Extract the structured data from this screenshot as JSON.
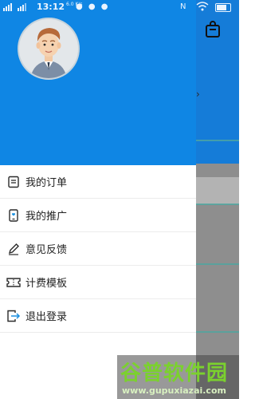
{
  "status_bar": {
    "time": "13:12",
    "speed": "6.0 K/s",
    "right_icons": "N",
    "signal_icon": "signal-bars-icon",
    "wifi_icon": "wifi-icon",
    "battery_icon": "battery-icon"
  },
  "drawer": {
    "avatar_icon": "user-avatar-icon",
    "menu": [
      {
        "label": "我的订单",
        "icon": "order-list-icon"
      },
      {
        "label": "我的推广",
        "icon": "promotion-phone-icon"
      },
      {
        "label": "意见反馈",
        "icon": "pencil-feedback-icon"
      },
      {
        "label": "计费模板",
        "icon": "ticket-template-icon"
      },
      {
        "label": "退出登录",
        "icon": "logout-icon"
      }
    ]
  },
  "background": {
    "bag_icon": "bag-icon"
  },
  "watermark": {
    "title": "谷普软件园",
    "url": "www.gupuxiazai.com"
  },
  "colors": {
    "header_blue": "#0f86e4",
    "accent_teal": "#4fa6a0",
    "icon_dark": "#2b2b2b",
    "watermark_green": "#7bd12e"
  }
}
